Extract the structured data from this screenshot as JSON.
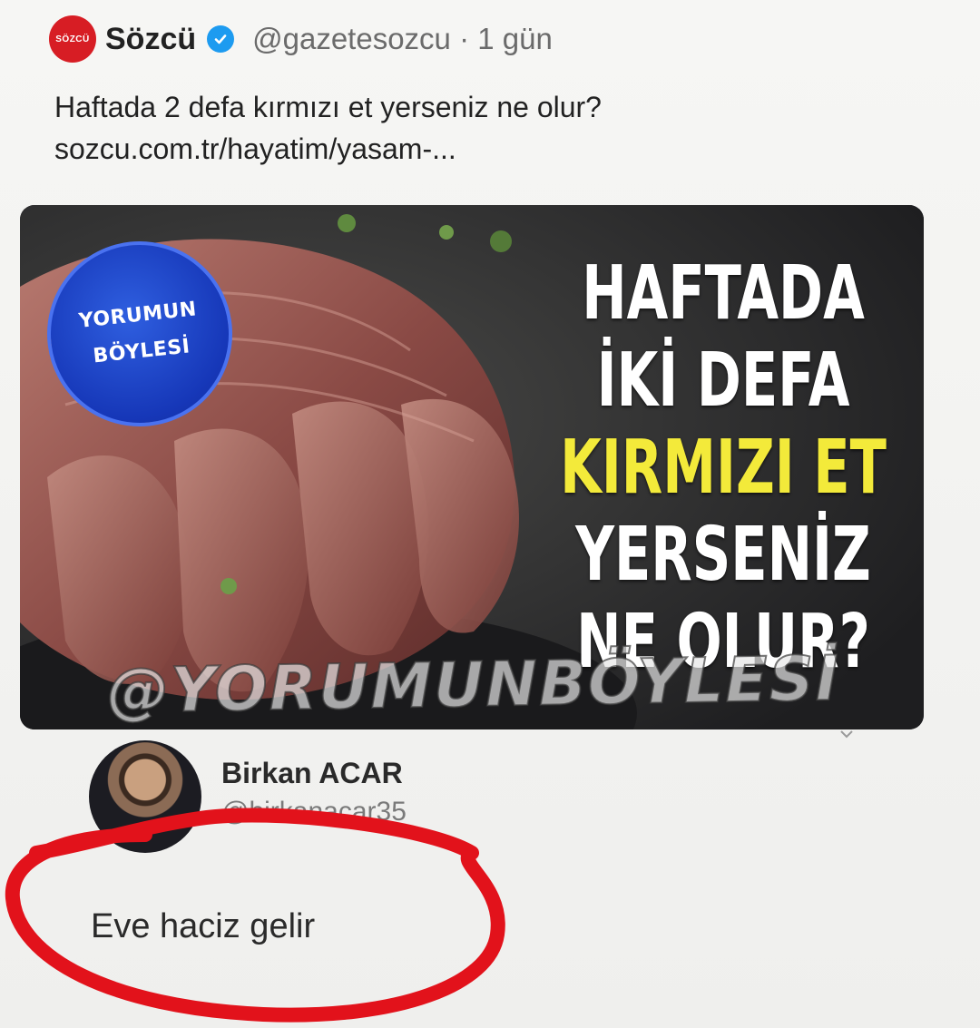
{
  "tweet": {
    "account_name": "Sözcü",
    "handle": "@gazetesozcu",
    "separator": "·",
    "time": "1 gün",
    "logo_text": "SÖZCÜ",
    "text_line_1": "Haftada 2 defa kırmızı et yerseniz ne olur?",
    "text_line_2": "sozcu.com.tr/hayatim/yasam-..."
  },
  "media": {
    "badge_line_1": "YORUMUN",
    "badge_line_2": "BÖYLESİ",
    "headline": [
      "HAFTADA",
      "İKİ DEFA",
      "KIRMIZI ET",
      "YERSENİZ",
      "NE OLUR?"
    ],
    "watermark": "@YORUMUNBÖYLESİ"
  },
  "reply": {
    "name": "Birkan ACAR",
    "handle": "@birkanacar35",
    "text": "Eve haciz gelir"
  },
  "colors": {
    "brand_red": "#d71d24",
    "verified_blue": "#1d9bf0",
    "badge_blue": "#1637b8",
    "headline_yellow": "#f3ea3a",
    "annotation_red": "#e2121b"
  },
  "icons": [
    "verified-icon",
    "chevron-down-icon"
  ]
}
